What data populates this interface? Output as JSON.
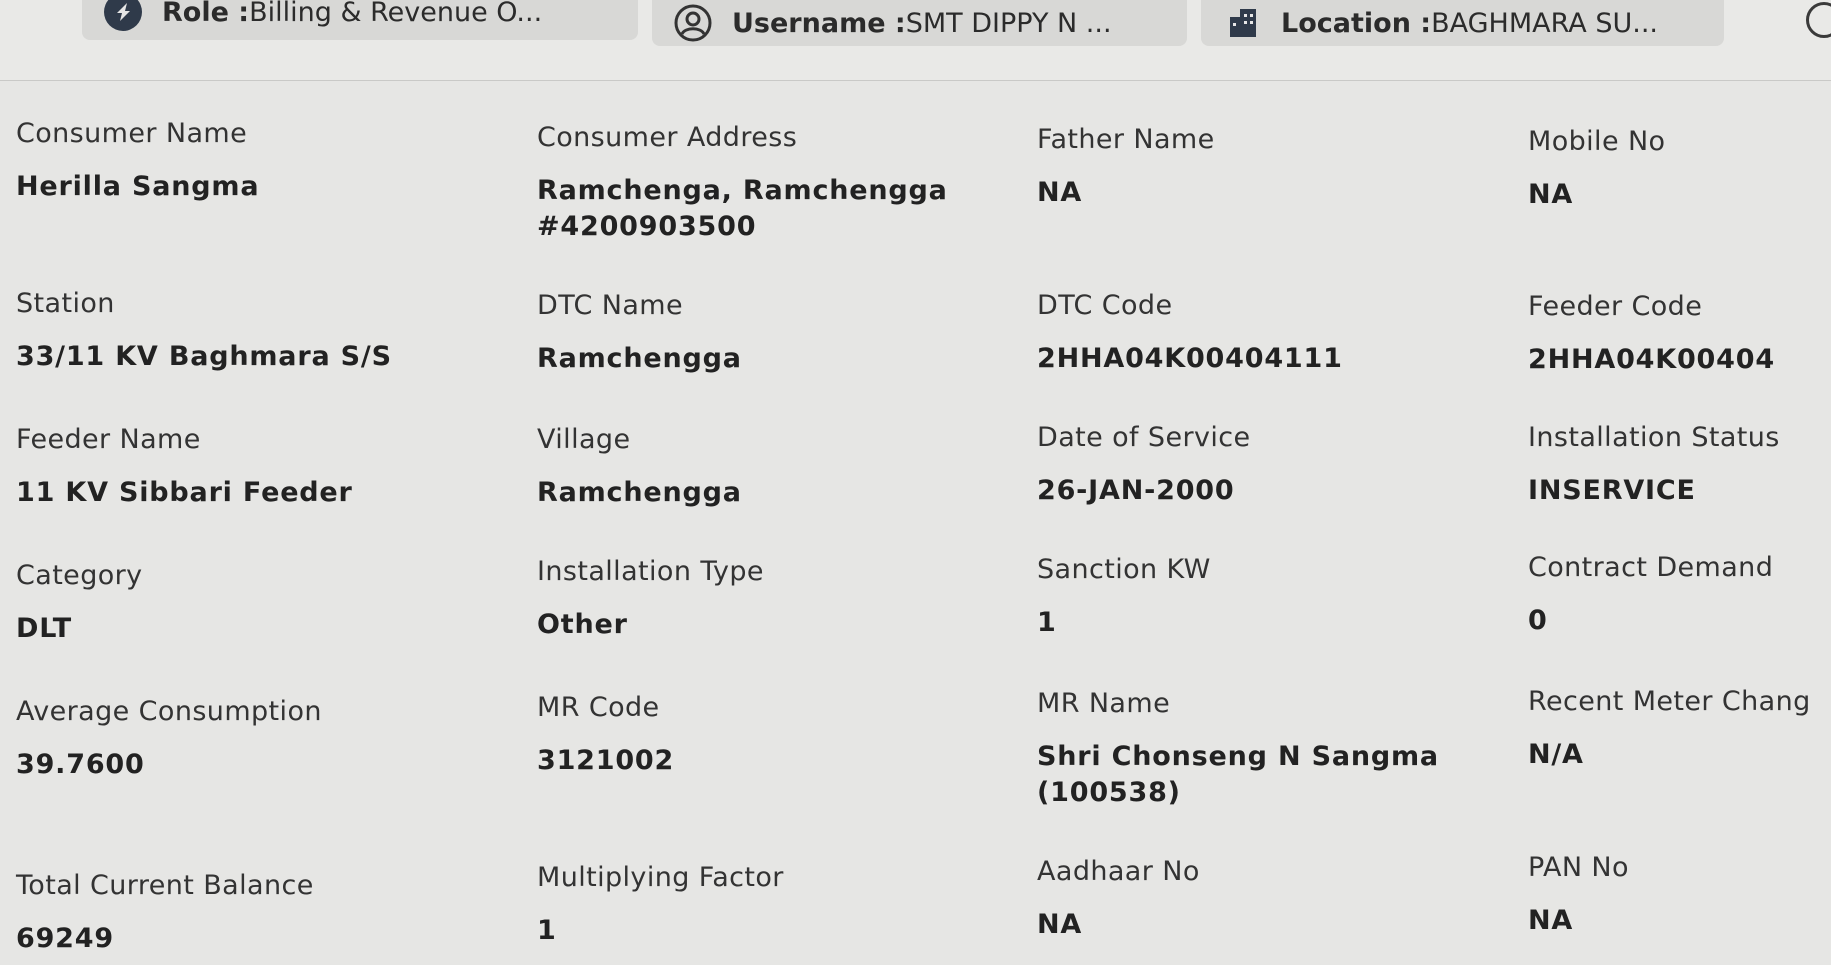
{
  "header": {
    "role": {
      "label": "Role :",
      "value": "Billing & Revenue O..."
    },
    "username": {
      "label": "Username :",
      "value": "SMT DIPPY N ..."
    },
    "location": {
      "label": "Location :",
      "value": "BAGHMARA SU..."
    }
  },
  "fields": {
    "consumer_name": {
      "label": "Consumer Name",
      "value": "Herilla Sangma"
    },
    "consumer_address": {
      "label": "Consumer Address",
      "value": "Ramchenga, Ramchengga #4200903500"
    },
    "father_name": {
      "label": "Father Name",
      "value": "NA"
    },
    "mobile_no": {
      "label": "Mobile No",
      "value": "NA"
    },
    "station": {
      "label": "Station",
      "value": "33/11 KV Baghmara S/S"
    },
    "dtc_name": {
      "label": "DTC Name",
      "value": "Ramchengga"
    },
    "dtc_code": {
      "label": "DTC Code",
      "value": "2HHA04K00404111"
    },
    "feeder_code": {
      "label": "Feeder Code",
      "value": "2HHA04K00404"
    },
    "feeder_name": {
      "label": "Feeder Name",
      "value": "11 KV Sibbari Feeder"
    },
    "village": {
      "label": "Village",
      "value": "Ramchengga"
    },
    "date_of_service": {
      "label": "Date of Service",
      "value": "26-JAN-2000"
    },
    "installation_status": {
      "label": "Installation Status",
      "value": "INSERVICE"
    },
    "category": {
      "label": "Category",
      "value": "DLT"
    },
    "installation_type": {
      "label": "Installation Type",
      "value": "Other"
    },
    "sanction_kw": {
      "label": "Sanction KW",
      "value": "1"
    },
    "contract_demand": {
      "label": "Contract Demand",
      "value": "0"
    },
    "average_consumption": {
      "label": "Average Consumption",
      "value": "39.7600"
    },
    "mr_code": {
      "label": "MR Code",
      "value": "3121002"
    },
    "mr_name": {
      "label": "MR Name",
      "value": "Shri Chonseng N Sangma (100538)"
    },
    "recent_meter_change": {
      "label": "Recent Meter Chang",
      "value": "N/A"
    },
    "total_current_balance": {
      "label": "Total Current Balance",
      "value": "69249"
    },
    "multiplying_factor": {
      "label": "Multiplying Factor",
      "value": "1"
    },
    "aadhaar_no": {
      "label": "Aadhaar No",
      "value": "NA"
    },
    "pan_no": {
      "label": "PAN No",
      "value": "NA"
    }
  },
  "icons": {
    "role": "role-icon",
    "username": "user-circle-icon",
    "location": "building-icon",
    "edge": "logout-icon"
  }
}
